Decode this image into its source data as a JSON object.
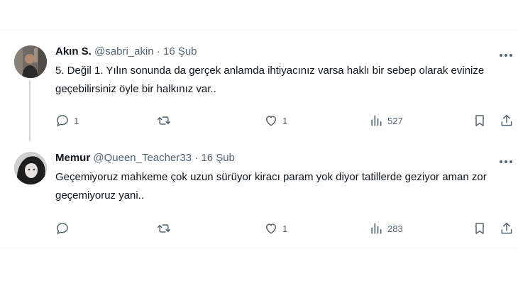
{
  "tweets": [
    {
      "display_name": "Akın S.",
      "handle": "@sabri_akin",
      "separator": "·",
      "date": "16 Şub",
      "text": "5. Değil 1. Yılın sonunda da gerçek anlamda ihtiyacınız varsa haklı bir sebep olarak evinize geçebilirsiniz öyle bir halkınız var..",
      "replies": "1",
      "retweets": "",
      "likes": "1",
      "views": "527"
    },
    {
      "display_name": "Memur",
      "handle": "@Queen_Teacher33",
      "separator": "·",
      "date": "16 Şub",
      "text": "Geçemiyoruz mahkeme çok uzun sürüyor kiracı param yok diyor tatillerde geziyor aman zor geçemiyoruz yani..",
      "replies": "",
      "retweets": "",
      "likes": "1",
      "views": "283"
    }
  ],
  "icons": {
    "more": "more-dots-icon",
    "reply": "reply-icon",
    "retweet": "retweet-icon",
    "like": "heart-icon",
    "views": "views-chart-icon",
    "bookmark": "bookmark-icon",
    "share": "share-icon"
  },
  "colors": {
    "text": "#0f1419",
    "secondary": "#536471",
    "divider": "#eff3f4",
    "thread_line": "#cfd9de"
  }
}
